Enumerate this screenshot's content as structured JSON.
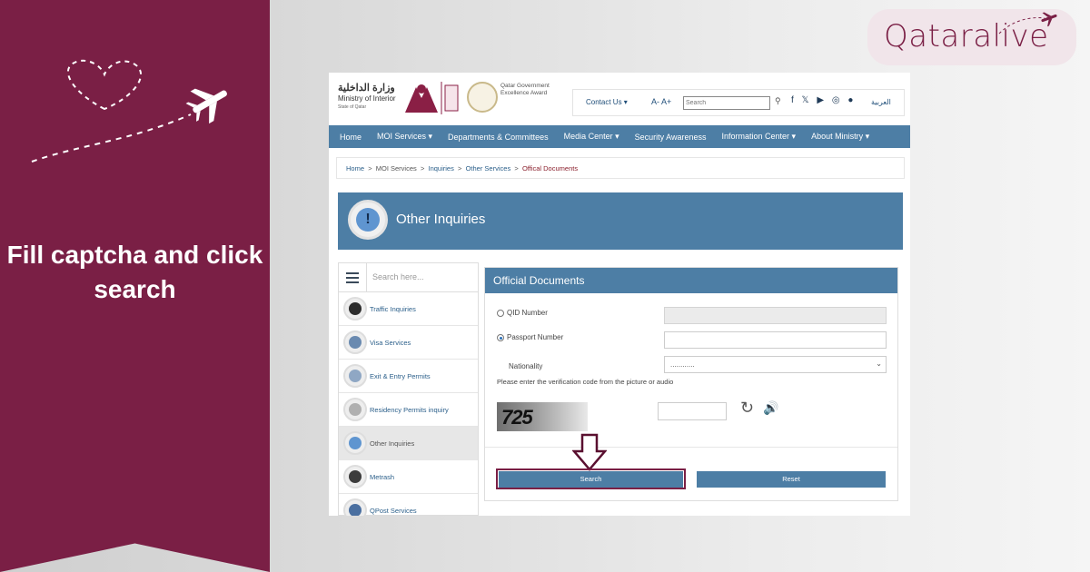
{
  "banner": {
    "caption": "Fill captcha and click search",
    "color": "#7a1f45"
  },
  "logo": {
    "text": "Qataralive",
    "icon": "airplane-icon"
  },
  "site": {
    "arabic_name": "وزارة الداخلية",
    "english_name": "Ministry of Interior",
    "state_line": "State of Qatar",
    "award_text": "Qatar Government Excellence Award",
    "contact_us": "Contact Us",
    "font_controls": "A- A+",
    "search_placeholder": "Search",
    "language_link": "العربية",
    "social_icons": [
      "facebook-icon",
      "x-icon",
      "youtube-icon",
      "instagram-icon",
      "snapchat-icon"
    ]
  },
  "nav": {
    "items": [
      "Home",
      "MOI Services ▾",
      "Departments & Committees",
      "Media Center ▾",
      "Security Awareness",
      "Information Center ▾",
      "About Ministry ▾"
    ]
  },
  "breadcrumb": {
    "home": "Home",
    "sep": ">",
    "moi_services": "MOI Services",
    "inquiries": "Inquiries",
    "other_services": "Other Services",
    "current": "Offical Documents"
  },
  "page_header": {
    "title": "Other Inquiries",
    "icon": "exclamation-icon"
  },
  "sidebar": {
    "search_placeholder": "Search here...",
    "items": [
      {
        "label": "Traffic Inquiries",
        "icon": "traffic-light-icon"
      },
      {
        "label": "Visa Services",
        "icon": "visa-icon"
      },
      {
        "label": "Exit & Entry Permits",
        "icon": "passport-icon"
      },
      {
        "label": "Residency Permits inquiry",
        "icon": "magnifier-icon"
      },
      {
        "label": "Other Inquiries",
        "icon": "exclamation-icon"
      },
      {
        "label": "Metrash",
        "icon": "phone-icon"
      },
      {
        "label": "QPost Services",
        "icon": "truck-icon"
      }
    ]
  },
  "form": {
    "title": "Official Documents",
    "qid_label": "QID Number",
    "passport_label": "Passport Number",
    "nationality_label": "Nationality",
    "nationality_value": "............",
    "verification_note": "Please enter the verification code from the picture or audio",
    "captcha_text": "725",
    "search_button": "Search",
    "reset_button": "Reset",
    "selected_option": "Passport Number"
  }
}
